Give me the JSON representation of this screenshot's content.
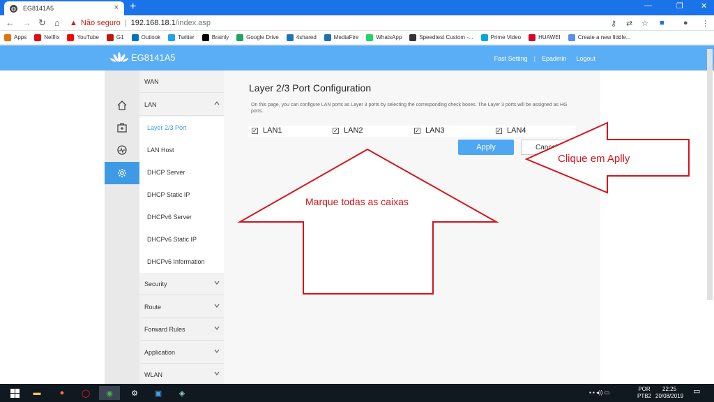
{
  "browser": {
    "tab_title": "EG8141A5",
    "security_label": "Não seguro",
    "url_host": "192.168.18.1",
    "url_path": "/index.asp"
  },
  "bookmarks": [
    {
      "label": "Apps",
      "color": "#e37400"
    },
    {
      "label": "Netflix",
      "color": "#e50914"
    },
    {
      "label": "YouTube",
      "color": "#ff0000"
    },
    {
      "label": "G1",
      "color": "#c4170c"
    },
    {
      "label": "Outlook",
      "color": "#0072c6"
    },
    {
      "label": "Twitter",
      "color": "#1da1f2"
    },
    {
      "label": "Brainly",
      "color": "#000000"
    },
    {
      "label": "Google Drive",
      "color": "#1fa463"
    },
    {
      "label": "4shared",
      "color": "#1b75bc"
    },
    {
      "label": "MediaFire",
      "color": "#1c70b6"
    },
    {
      "label": "WhatsApp",
      "color": "#25d366"
    },
    {
      "label": "Speedtest Custom -...",
      "color": "#333333"
    },
    {
      "label": "Prime Video",
      "color": "#00a8e1"
    },
    {
      "label": "HUAWEI",
      "color": "#cf0a2c"
    },
    {
      "label": "Create a new fiddle...",
      "color": "#5b8def"
    }
  ],
  "header": {
    "logo_text": "EG8141A5",
    "links": [
      "Fast Setting",
      "Epadmin",
      "Logout"
    ],
    "divider": "|"
  },
  "menu": {
    "wan": "WAN",
    "lan": "LAN",
    "lan_sub": [
      "Layer 2/3 Port",
      "LAN Host",
      "DHCP Server",
      "DHCP Static IP",
      "DHCPv6 Server",
      "DHCPv6 Static IP",
      "DHCPv6 Information"
    ],
    "sections": [
      "Security",
      "Route",
      "Forward Rules",
      "Application",
      "WLAN"
    ]
  },
  "page": {
    "title": "Layer 2/3 Port Configuration",
    "description": "On this page, you can configure LAN ports as Layer 3 ports by selecting the corresponding check boxes. The Layer 3 ports will be assigned as HG ports.",
    "ports": [
      {
        "label": "LAN1",
        "checked": true
      },
      {
        "label": "LAN2",
        "checked": true
      },
      {
        "label": "LAN3",
        "checked": true
      },
      {
        "label": "LAN4",
        "checked": true
      }
    ],
    "apply": "Apply",
    "cancel": "Cancel"
  },
  "annotations": {
    "right_arrow_text": "Clique em Aplly",
    "up_arrow_text": "Marque todas as caixas",
    "color": "#d4141c"
  },
  "taskbar": {
    "lang1": "POR",
    "lang2": "PTB2",
    "time": "22:25",
    "date": "20/08/2019"
  }
}
